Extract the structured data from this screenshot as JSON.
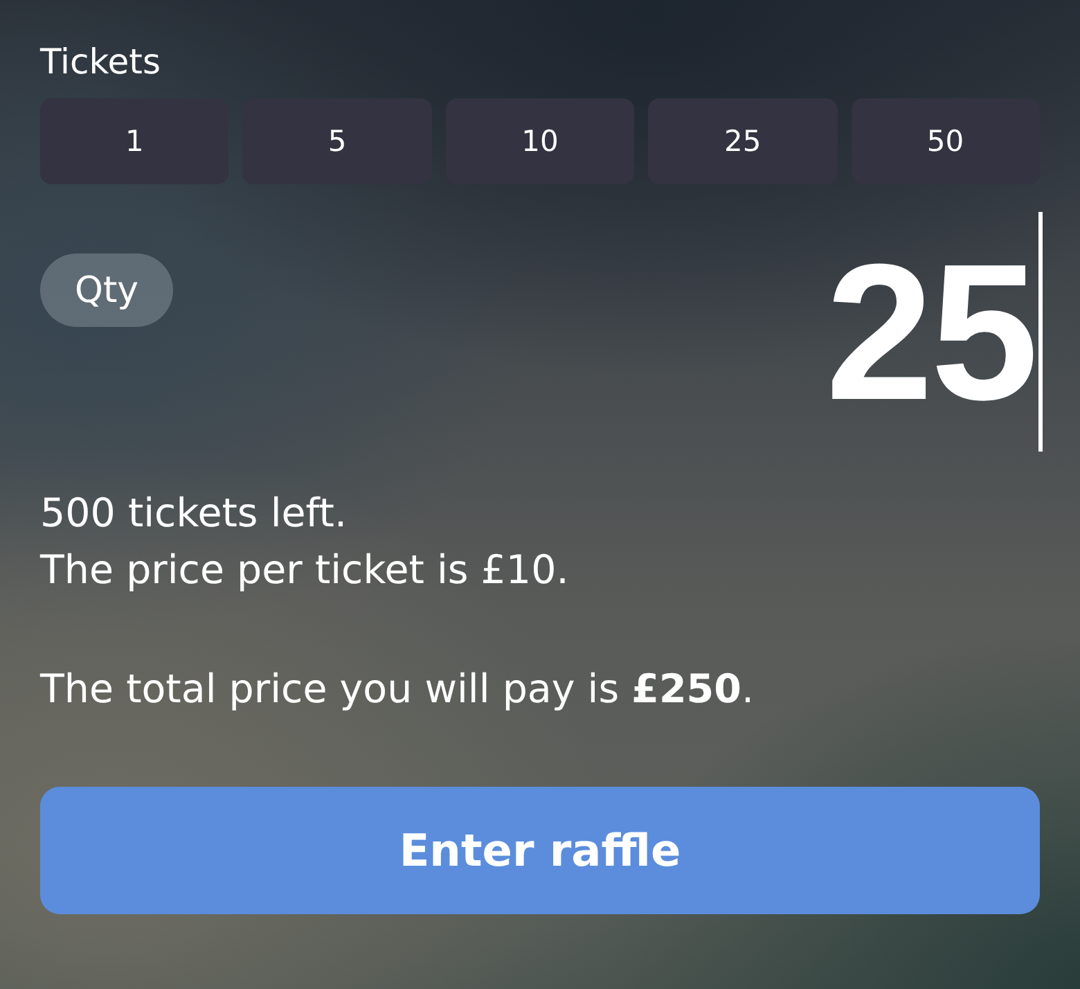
{
  "presets": {
    "label": "Tickets",
    "options": [
      "1",
      "5",
      "10",
      "25",
      "50"
    ]
  },
  "quantity": {
    "label": "Qty",
    "value": "25"
  },
  "info": {
    "lines": [
      "500 tickets left.",
      "The price per ticket is £10."
    ],
    "total": "The total price you will pay is **£250**."
  },
  "submit_button": {
    "label": "Enter raffle"
  }
}
